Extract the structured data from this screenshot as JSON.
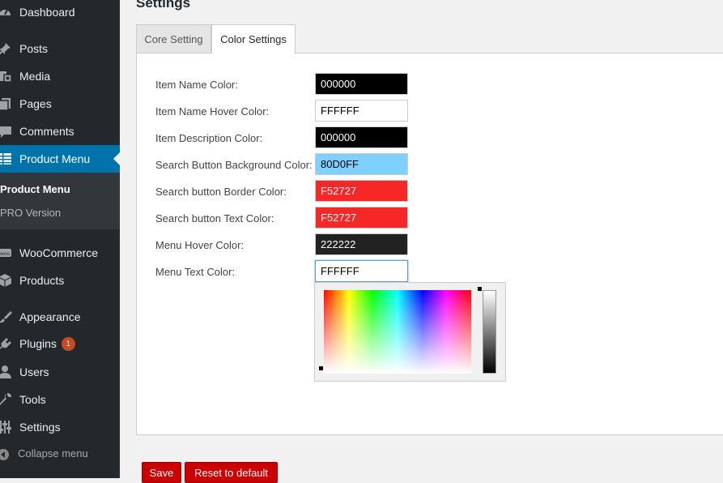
{
  "sidebar": {
    "items": [
      {
        "label": "Dashboard",
        "icon": "dashboard-icon"
      },
      {
        "label": "Posts",
        "icon": "pin-icon"
      },
      {
        "label": "Media",
        "icon": "media-icon"
      },
      {
        "label": "Pages",
        "icon": "pages-icon"
      },
      {
        "label": "Comments",
        "icon": "comment-icon"
      },
      {
        "label": "Product Menu",
        "icon": "list-icon",
        "active": true
      },
      {
        "label": "WooCommerce",
        "icon": "woo-icon"
      },
      {
        "label": "Products",
        "icon": "box-icon"
      },
      {
        "label": "Appearance",
        "icon": "brush-icon"
      },
      {
        "label": "Plugins",
        "icon": "plug-icon",
        "badge": "1"
      },
      {
        "label": "Users",
        "icon": "user-icon"
      },
      {
        "label": "Tools",
        "icon": "wrench-icon"
      },
      {
        "label": "Settings",
        "icon": "sliders-icon"
      }
    ],
    "submenu": [
      {
        "label": "Product Menu",
        "current": true
      },
      {
        "label": "PRO Version",
        "current": false
      }
    ],
    "collapse_label": "Collapse menu"
  },
  "page": {
    "title": "Settings",
    "tabs": [
      {
        "label": "Core Setting",
        "active": false
      },
      {
        "label": "Color Settings",
        "active": true
      }
    ]
  },
  "form": {
    "rows": [
      {
        "label": "Item Name Color:",
        "value": "000000",
        "bg": "#000000",
        "fg": "#ffffff"
      },
      {
        "label": "Item Name Hover Color:",
        "value": "FFFFFF",
        "bg": "#ffffff",
        "fg": "#000000"
      },
      {
        "label": "Item Description Color:",
        "value": "000000",
        "bg": "#000000",
        "fg": "#ffffff"
      },
      {
        "label": "Search Button Background Color:",
        "value": "80D0FF",
        "bg": "#80d0ff",
        "fg": "#000000"
      },
      {
        "label": "Search button Border Color:",
        "value": "F52727",
        "bg": "#f52727",
        "fg": "#ffffff"
      },
      {
        "label": "Search button Text Color:",
        "value": "F52727",
        "bg": "#f52727",
        "fg": "#ffffff"
      },
      {
        "label": "Menu Hover Color:",
        "value": "222222",
        "bg": "#222222",
        "fg": "#ffffff"
      },
      {
        "label": "Menu Text Color:",
        "value": "FFFFFF",
        "bg": "#ffffff",
        "fg": "#000000",
        "focused": true
      }
    ]
  },
  "buttons": {
    "save": "Save",
    "reset": "Reset to default"
  },
  "colors": {
    "sidebar_bg": "#23282d",
    "active_blue": "#0073aa",
    "button_red": "#cc0000"
  }
}
